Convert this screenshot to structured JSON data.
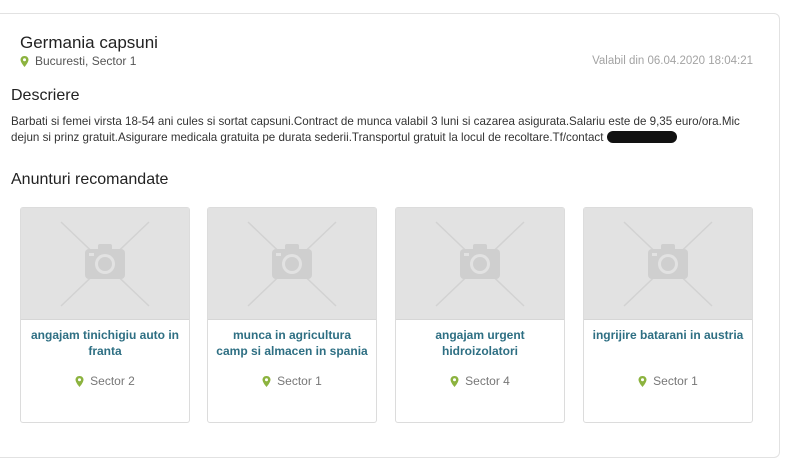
{
  "listing": {
    "title": "Germania capsuni",
    "location": "Bucuresti, Sector 1",
    "valid_from": "Valabil din 06.04.2020 18:04:21"
  },
  "description": {
    "heading": "Descriere",
    "text": "Barbati si femei virsta 18-54 ani cules si sortat capsuni.Contract de munca valabil 3 luni si cazarea asigurata.Salariu este de 9,35 euro/ora.Mic dejun si prinz gratuit.Asigurare medicala gratuita pe durata sederii.Transportul gratuit la locul de recoltare.Tf/contact"
  },
  "recommended": {
    "heading": "Anunturi recomandate",
    "cards": [
      {
        "title": "angajam tinichigiu auto in franta",
        "location": "Sector 2"
      },
      {
        "title": "munca in agricultura camp si almacen in spania",
        "location": "Sector 1"
      },
      {
        "title": "angajam urgent hidroizolatori",
        "location": "Sector 4"
      },
      {
        "title": "ingrijire batarani in austria",
        "location": "Sector 1"
      }
    ]
  },
  "icons": {
    "pin": "map-pin-icon",
    "placeholder": "camera-placeholder-icon"
  },
  "colors": {
    "pin": "#8cb33f",
    "card_title": "#2e6f83",
    "placeholder_bg": "#e2e2e2"
  }
}
